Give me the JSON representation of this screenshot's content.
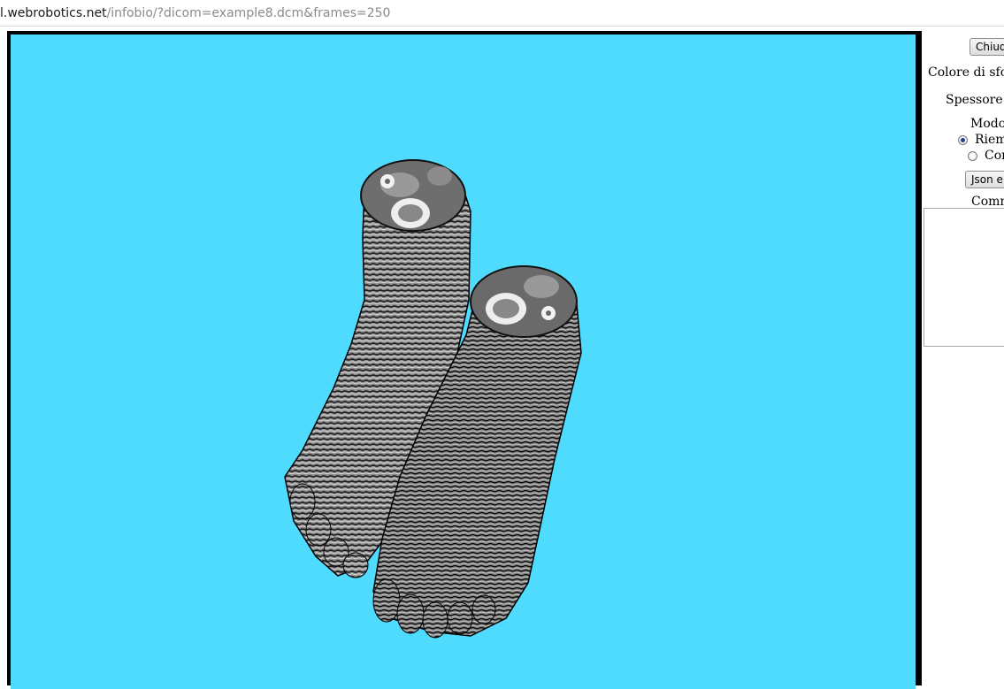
{
  "url": {
    "domain": "l.webrobotics.net",
    "path": "/infobio/?dicom=example8.dcm&frames=250"
  },
  "viewer": {
    "background_color": "#4edbfe",
    "border_color": "#000000",
    "content": "3d-rendered-feet-volume"
  },
  "panel": {
    "close_button": "Chiud",
    "bg_color_label": "Colore di sfon",
    "thickness_label": "Spessore s",
    "mode_label": "Modo",
    "mode_options": [
      {
        "label": "Riemp",
        "checked": true
      },
      {
        "label": "Cor",
        "checked": false
      }
    ],
    "json_button": "Json e",
    "comment_label": "Comm",
    "comment_value": ""
  }
}
